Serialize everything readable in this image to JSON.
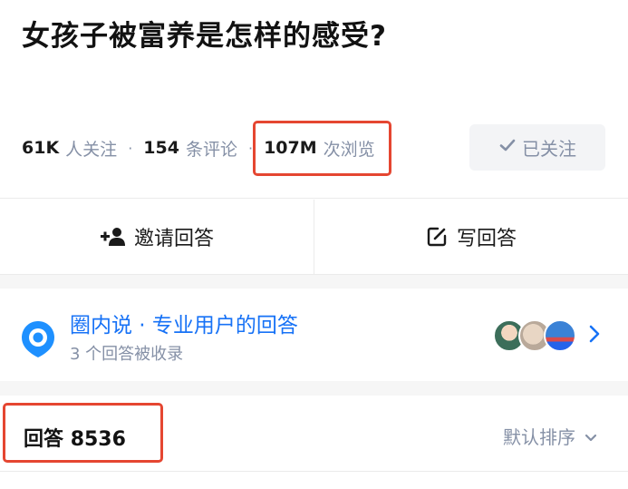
{
  "question": {
    "title": "女孩子被富养是怎样的感受?"
  },
  "stats": {
    "followers_num": "61K",
    "followers_label": "人关注",
    "separator": "·",
    "comments_num": "154",
    "comments_label": "条评论",
    "views_num": "107M",
    "views_label": "次浏览"
  },
  "follow_button": {
    "icon": "check-icon",
    "label": "已关注"
  },
  "actions": {
    "invite": {
      "icon": "add-user-icon",
      "label": "邀请回答"
    },
    "write": {
      "icon": "edit-icon",
      "label": "写回答"
    }
  },
  "circle": {
    "icon": "location-bubble-icon",
    "title": "圈内说 · 专业用户的回答",
    "subtitle": "3 个回答被收录",
    "accent_color": "#1772f6"
  },
  "answers": {
    "label": "回答",
    "count": "8536",
    "sort_label": "默认排序"
  },
  "colors": {
    "highlight_border": "#e54631",
    "muted_text": "#8590a6",
    "band_background": "#f6f6f6"
  }
}
